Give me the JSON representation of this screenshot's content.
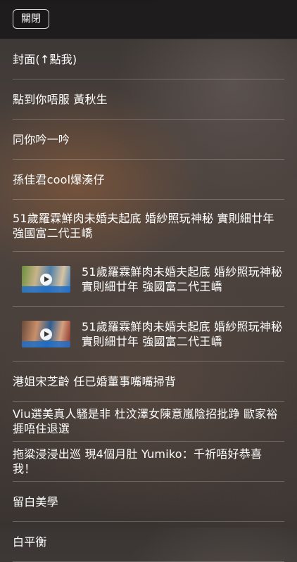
{
  "header": {
    "close_label": "關閉"
  },
  "items": [
    {
      "label": "封面(↑點我)"
    },
    {
      "label": "點到你唔服 黃秋生"
    },
    {
      "label": "同你吟一吟"
    },
    {
      "label": "孫佳君cool爆湊仔"
    },
    {
      "label": "51歲羅霖鮮肉未婚夫起底 婚紗照玩神秘 實則細廿年強國富二代王嶠"
    },
    {
      "label": "51歲羅霖鮮肉未婚夫起底 婚紗照玩神秘實則細廿年 強國富二代王嶠",
      "video_icon": "play-icon"
    },
    {
      "label": "51歲羅霖鮮肉未婚夫起底 婚紗照玩神秘實則細廿年 強國富二代王嶠",
      "video_icon": "play-icon"
    },
    {
      "label": "港姐宋芝齡 任已婚董事嘴嘴掃背"
    },
    {
      "label": "Viu選美真人騷是非 杜汶澤女陳意嵐陰招批踭 歐家裕捱唔住退選"
    },
    {
      "label": "拖粱浸浸出巡 現4個月肚 Yumiko：千祈唔好恭喜我！"
    },
    {
      "label": "留白美學"
    },
    {
      "label": "白平衡"
    }
  ]
}
